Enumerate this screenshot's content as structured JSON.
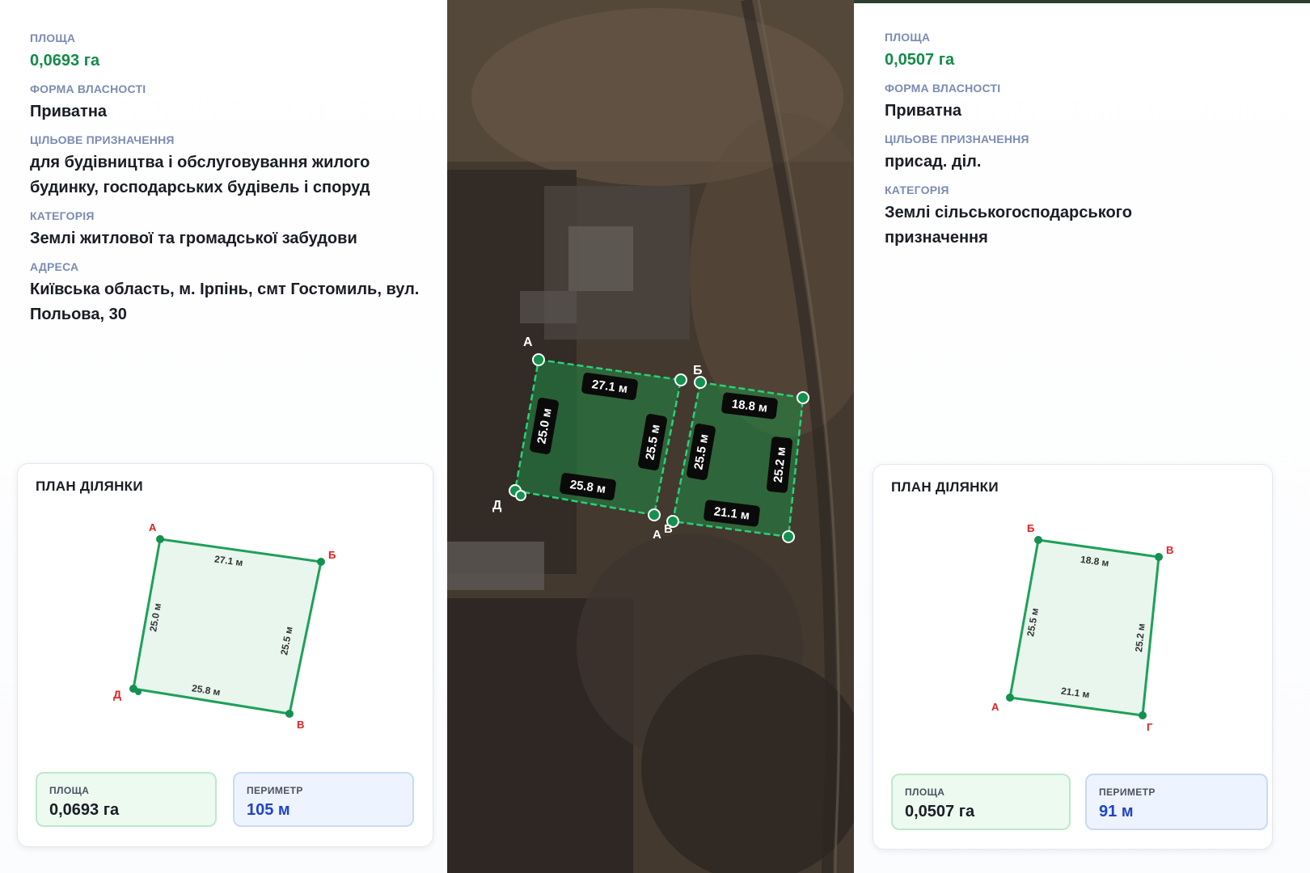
{
  "left": {
    "fields": [
      {
        "label": "ПЛОЩА",
        "value": "0,0693 га",
        "accent": true
      },
      {
        "label": "ФОРМА ВЛАСНОСТІ",
        "value": "Приватна"
      },
      {
        "label": "ЦІЛЬОВЕ ПРИЗНАЧЕННЯ",
        "value": "для будівництва і обслуговування жилого будинку, господарських будівель і споруд"
      },
      {
        "label": "КАТЕГОРІЯ",
        "value": "Землі житлової та громадської забудови"
      },
      {
        "label": "АДРЕСА",
        "value": "Київська область, м. Ірпінь, смт Гостомиль, вул. Польова, 30"
      }
    ],
    "plan": {
      "title": "ПЛАН ДІЛЯНКИ",
      "vertices": [
        "А",
        "Б",
        "В",
        "Д"
      ],
      "sides": [
        "27.1 м",
        "25.5 м",
        "25.8 м",
        "25.0 м"
      ],
      "area_label": "ПЛОЩА",
      "area_value": "0,0693 га",
      "perimeter_label": "ПЕРИМЕТР",
      "perimeter_value": "105 м"
    }
  },
  "right": {
    "fields": [
      {
        "label": "ПЛОЩА",
        "value": "0,0507 га",
        "accent": true
      },
      {
        "label": "ФОРМА ВЛАСНОСТІ",
        "value": "Приватна"
      },
      {
        "label": "ЦІЛЬОВЕ ПРИЗНАЧЕННЯ",
        "value": "присад. діл."
      },
      {
        "label": "КАТЕГОРІЯ",
        "value": "Землі сільськогосподарського призначення"
      }
    ],
    "plan": {
      "title": "ПЛАН ДІЛЯНКИ",
      "vertices": [
        "Б",
        "В",
        "Г",
        "А"
      ],
      "sides": [
        "18.8 м",
        "25.2 м",
        "21.1 м",
        "25.5 м"
      ],
      "area_label": "ПЛОЩА",
      "area_value": "0,0507 га",
      "perimeter_label": "ПЕРИМЕТР",
      "perimeter_value": "91 м"
    }
  },
  "map": {
    "plot1": {
      "vertices": [
        "А",
        "Д"
      ],
      "sides": [
        "27.1 м",
        "25.5 м",
        "25.8 м",
        "25.0 м"
      ]
    },
    "plot2": {
      "vertices": [
        "Б",
        "А",
        "В"
      ],
      "sides": [
        "18.8 м",
        "25.2 м",
        "21.1 м",
        "25.5 м"
      ]
    }
  },
  "colors": {
    "accent_green": "#148a4a",
    "label_blue_gray": "#7b8bb3",
    "plot_stroke": "#1fa05a",
    "vertex_red": "#e02020",
    "perimeter_blue": "#1f43c9"
  }
}
